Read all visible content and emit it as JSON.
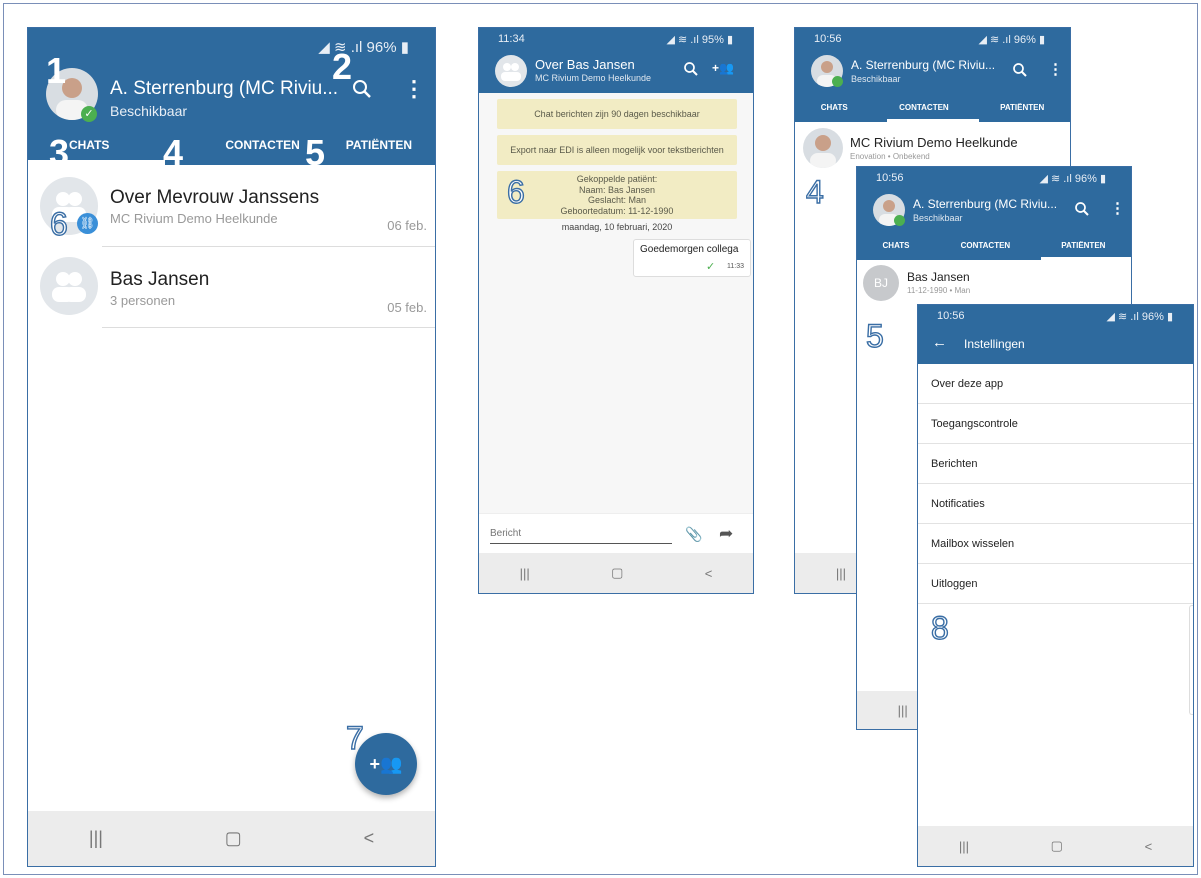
{
  "phone1": {
    "status": "96%",
    "user_name": "A. Sterrenburg (MC Riviu...",
    "user_status": "Beschikbaar",
    "tabs": [
      "CHATS",
      "CONTACTEN",
      "PATIËNTEN"
    ],
    "chats": [
      {
        "title": "Over Mevrouw Janssens",
        "subtitle": "MC Rivium Demo Heelkunde",
        "date": "06 feb."
      },
      {
        "title": "Bas Jansen",
        "subtitle": "3 personen",
        "date": "05 feb."
      }
    ]
  },
  "phone2": {
    "time": "11:34",
    "status": "95%",
    "title": "Over Bas Jansen",
    "subtitle": "MC Rivium Demo Heelkunde",
    "banner1": "Chat berichten zijn 90 dagen beschikbaar",
    "banner2": "Export naar EDI is alleen mogelijk voor tekstberichten",
    "patient_lines": [
      "Gekoppelde patiënt:",
      "Naam: Bas Jansen",
      "Geslacht: Man",
      "Geboortedatum: 11-12-1990"
    ],
    "date_sep": "maandag, 10 februari, 2020",
    "message": "Goedemorgen collega",
    "msg_time": "11:33",
    "input_placeholder": "Bericht"
  },
  "phone3": {
    "time": "10:56",
    "status": "96%",
    "user_name": "A. Sterrenburg (MC Riviu...",
    "user_status": "Beschikbaar",
    "tabs": [
      "CHATS",
      "CONTACTEN",
      "PATIËNTEN"
    ],
    "contact_name": "MC Rivium Demo Heelkunde",
    "contact_sub": "Enovation • Onbekend"
  },
  "phone4": {
    "time": "10:56",
    "status": "96%",
    "user_name": "A. Sterrenburg (MC Riviu...",
    "user_status": "Beschikbaar",
    "tabs": [
      "CHATS",
      "CONTACTEN",
      "PATIËNTEN"
    ],
    "patient_initials": "BJ",
    "patient_name": "Bas Jansen",
    "patient_sub": "11-12-1990 • Man"
  },
  "phone5": {
    "time": "10:56",
    "status": "96%",
    "title": "Instellingen",
    "items": [
      "Over deze app",
      "Toegangscontrole",
      "Berichten",
      "Notificaties",
      "Mailbox wisselen",
      "Uitloggen"
    ]
  },
  "annotations": [
    "1",
    "2",
    "3",
    "4",
    "5",
    "6",
    "7",
    "8"
  ],
  "colors": {
    "header": "#2e6a9e",
    "banner": "#f2ecc4",
    "check": "#4caf50"
  }
}
